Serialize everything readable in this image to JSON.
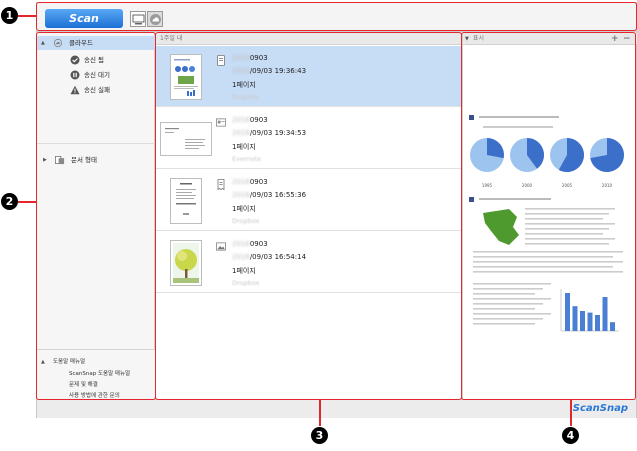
{
  "toolbar": {
    "scan_label": "Scan",
    "view_pc": "computer-view-icon",
    "view_cloud": "cloud-view-icon"
  },
  "left_panel": {
    "cloud": {
      "label": "클라우드",
      "icon": "cloud-icon"
    },
    "sent": {
      "label": "송신 됨",
      "icon": "cloud-check-icon"
    },
    "pending": {
      "label": "송신 대기",
      "icon": "pause-icon"
    },
    "failed": {
      "label": "송신 실패",
      "icon": "warning-icon"
    },
    "doc_type": {
      "label": "문서 형태",
      "icon": "document-type-icon"
    },
    "help": {
      "header": "도움말 매뉴얼",
      "items": [
        "ScanSnap 도움말 매뉴얼",
        "문제 및 해결",
        "사용 방법에 관한 문의"
      ]
    }
  },
  "middle": {
    "header": "1주일 내",
    "rows": [
      {
        "name_blur": "2016",
        "name": "0903",
        "date_blur": "2016",
        "date": "/09/03 19:36:43",
        "pages": "1페이지",
        "source": "Dropbox",
        "type": "document"
      },
      {
        "name_blur": "2016",
        "name": "0903",
        "date_blur": "2016",
        "date": "/09/03 19:34:53",
        "pages": "1페이지",
        "source": "Evernote",
        "type": "business-card"
      },
      {
        "name_blur": "2016",
        "name": "0903",
        "date_blur": "2016",
        "date": "/09/03 16:55:36",
        "pages": "1페이지",
        "source": "Dropbox",
        "type": "receipt"
      },
      {
        "name_blur": "2016",
        "name": "0903",
        "date_blur": "2016",
        "date": "/09/03 16:54:14",
        "pages": "1페이지",
        "source": "Dropbox",
        "type": "photo"
      }
    ]
  },
  "preview": {
    "header": "표시",
    "zoom_in": "+",
    "zoom_out": "−",
    "pie_years": [
      "1995",
      "2000",
      "2005",
      "2010"
    ],
    "pie_values": [
      0.28,
      0.4,
      0.58,
      0.72
    ],
    "bar_values": [
      0.95,
      0.62,
      0.5,
      0.46,
      0.4,
      0.85,
      0.22
    ]
  },
  "statusbar": {
    "logo": "ScanSnap"
  },
  "callouts": [
    "1",
    "2",
    "3",
    "4"
  ],
  "colors": {
    "accent": "#1d6fd6",
    "callout": "#e5262c",
    "selection": "#c7dcf5",
    "chart": "#3b6fc9"
  }
}
